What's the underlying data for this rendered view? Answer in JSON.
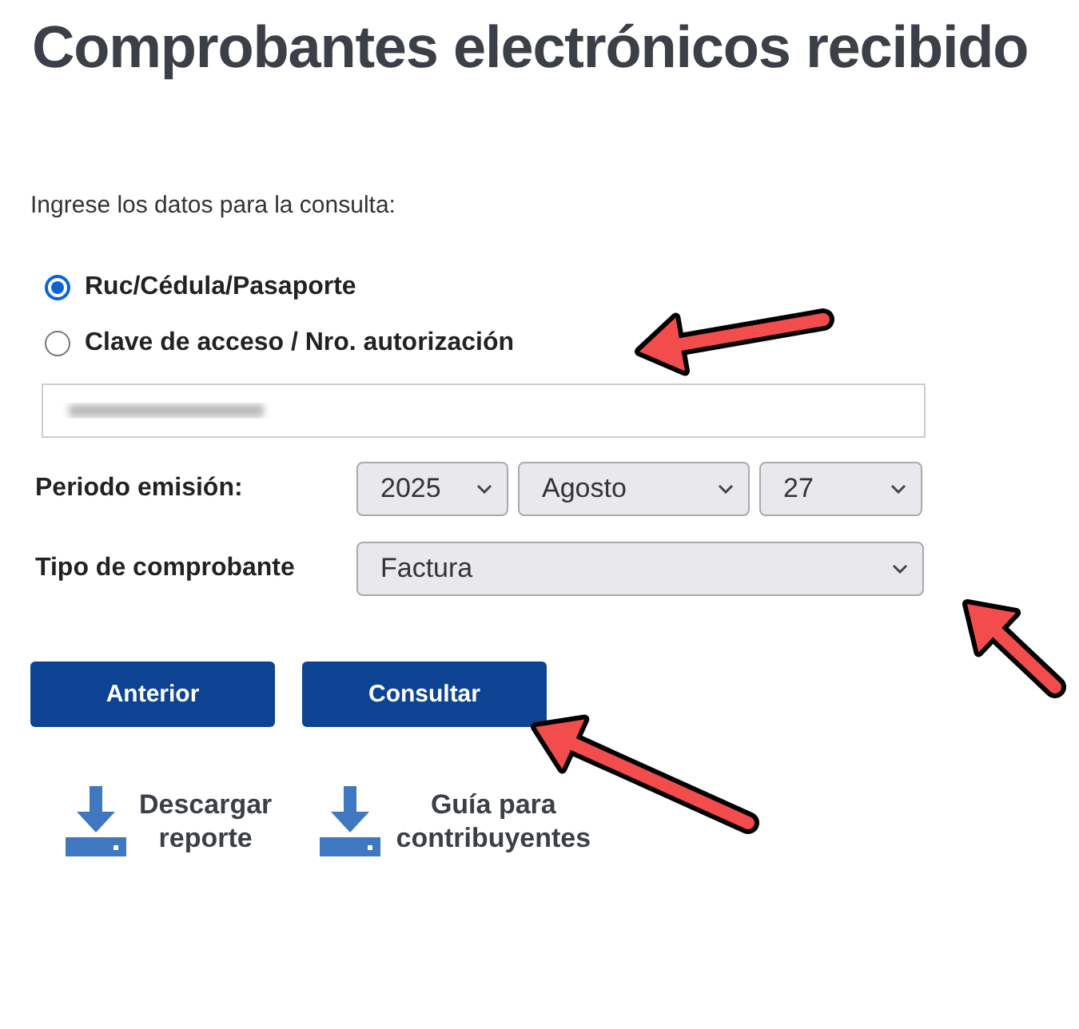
{
  "title": "Comprobantes electrónicos recibido",
  "prompt": "Ingrese los datos para la consulta:",
  "search_by": [
    {
      "label": "Ruc/Cédula/Pasaporte",
      "selected": true
    },
    {
      "label": "Clave de acceso / Nro. autorización",
      "selected": false
    }
  ],
  "period": {
    "label": "Periodo emisión:",
    "year": "2025",
    "month": "Agosto",
    "day": "27"
  },
  "voucher_type": {
    "label": "Tipo de comprobante",
    "value": "Factura"
  },
  "buttons": [
    "Anterior",
    "Consultar"
  ],
  "links": [
    {
      "label": "Descargar reporte"
    },
    {
      "label": "Guía para contribuyentes"
    }
  ]
}
